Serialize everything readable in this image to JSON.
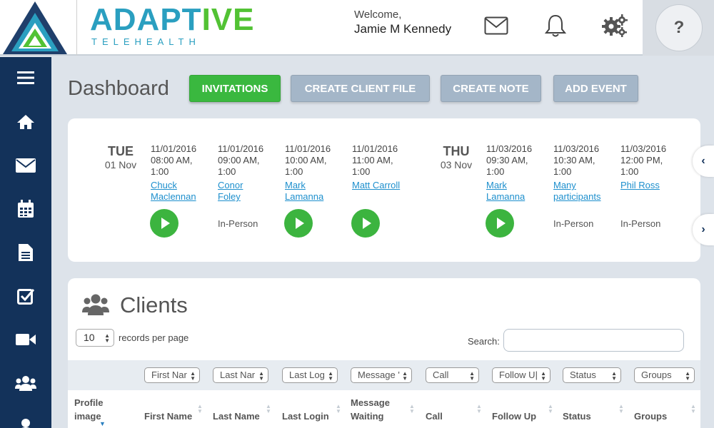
{
  "header": {
    "brand_main": "ADAPT",
    "brand_accent": "IVE",
    "brand_sub": "TELEHEALTH",
    "welcome_label": "Welcome,",
    "user_name": "Jamie M Kennedy",
    "help_label": "?"
  },
  "page": {
    "title": "Dashboard"
  },
  "actions": {
    "invitations": "INVITATIONS",
    "create_client_file": "CREATE CLIENT FILE",
    "create_note": "CREATE NOTE",
    "add_event": "ADD EVENT"
  },
  "schedule": {
    "days": [
      {
        "name": "TUE",
        "date": "01 Nov"
      },
      {
        "name": "THU",
        "date": "03 Nov"
      }
    ],
    "events": [
      {
        "date": "11/01/2016",
        "time": "08:00 AM,",
        "duration": "1:00",
        "name_1": "Chuck",
        "name_2": "Maclennan",
        "mode": "video"
      },
      {
        "date": "11/01/2016",
        "time": "09:00 AM,",
        "duration": "1:00",
        "name_1": "Conor",
        "name_2": "Foley",
        "mode": "In-Person"
      },
      {
        "date": "11/01/2016",
        "time": "10:00 AM,",
        "duration": "1:00",
        "name_1": "Mark",
        "name_2": "Lamanna",
        "mode": "video"
      },
      {
        "date": "11/01/2016",
        "time": "11:00 AM,",
        "duration": "1:00",
        "name_1": "Matt Carroll",
        "name_2": "",
        "mode": "video"
      },
      {
        "date": "11/03/2016",
        "time": "09:30 AM,",
        "duration": "1:00",
        "name_1": "Mark",
        "name_2": "Lamanna",
        "mode": "video"
      },
      {
        "date": "11/03/2016",
        "time": "10:30 AM,",
        "duration": "1:00",
        "name_1": "Many",
        "name_2": "participants",
        "mode": "In-Person"
      },
      {
        "date": "11/03/2016",
        "time": "12:00 PM,",
        "duration": "1:00",
        "name_1": "Phil Ross",
        "name_2": "",
        "mode": "In-Person"
      }
    ],
    "prev_label": "‹",
    "next_label": "›"
  },
  "clients": {
    "title": "Clients",
    "page_size": "10",
    "records_per_page_label": "records per page",
    "search_label": "Search:",
    "search_value": "",
    "filters": [
      "First Nar",
      "Last Nar",
      "Last Log",
      "Message '",
      "Call",
      "Follow U|",
      "Status",
      "Groups"
    ],
    "columns": {
      "profile_1": "Profile",
      "profile_2": "image",
      "first_name": "First Name",
      "last_name": "Last Name",
      "last_login": "Last Login",
      "message_1": "Message",
      "message_2": "Waiting",
      "call": "Call",
      "follow_up": "Follow Up",
      "status": "Status",
      "groups": "Groups"
    }
  },
  "sidebar": {
    "items": [
      "menu-icon",
      "home-icon",
      "mail-icon",
      "calendar-icon",
      "document-icon",
      "checklist-icon",
      "video-icon",
      "group-icon",
      "user-icon"
    ]
  },
  "colors": {
    "brand_blue": "#2a9fc0",
    "brand_green": "#52c234",
    "sidebar": "#13325a",
    "primary_button": "#3ab83f",
    "secondary_button": "#a4b6c8",
    "link": "#1d8fcd"
  }
}
